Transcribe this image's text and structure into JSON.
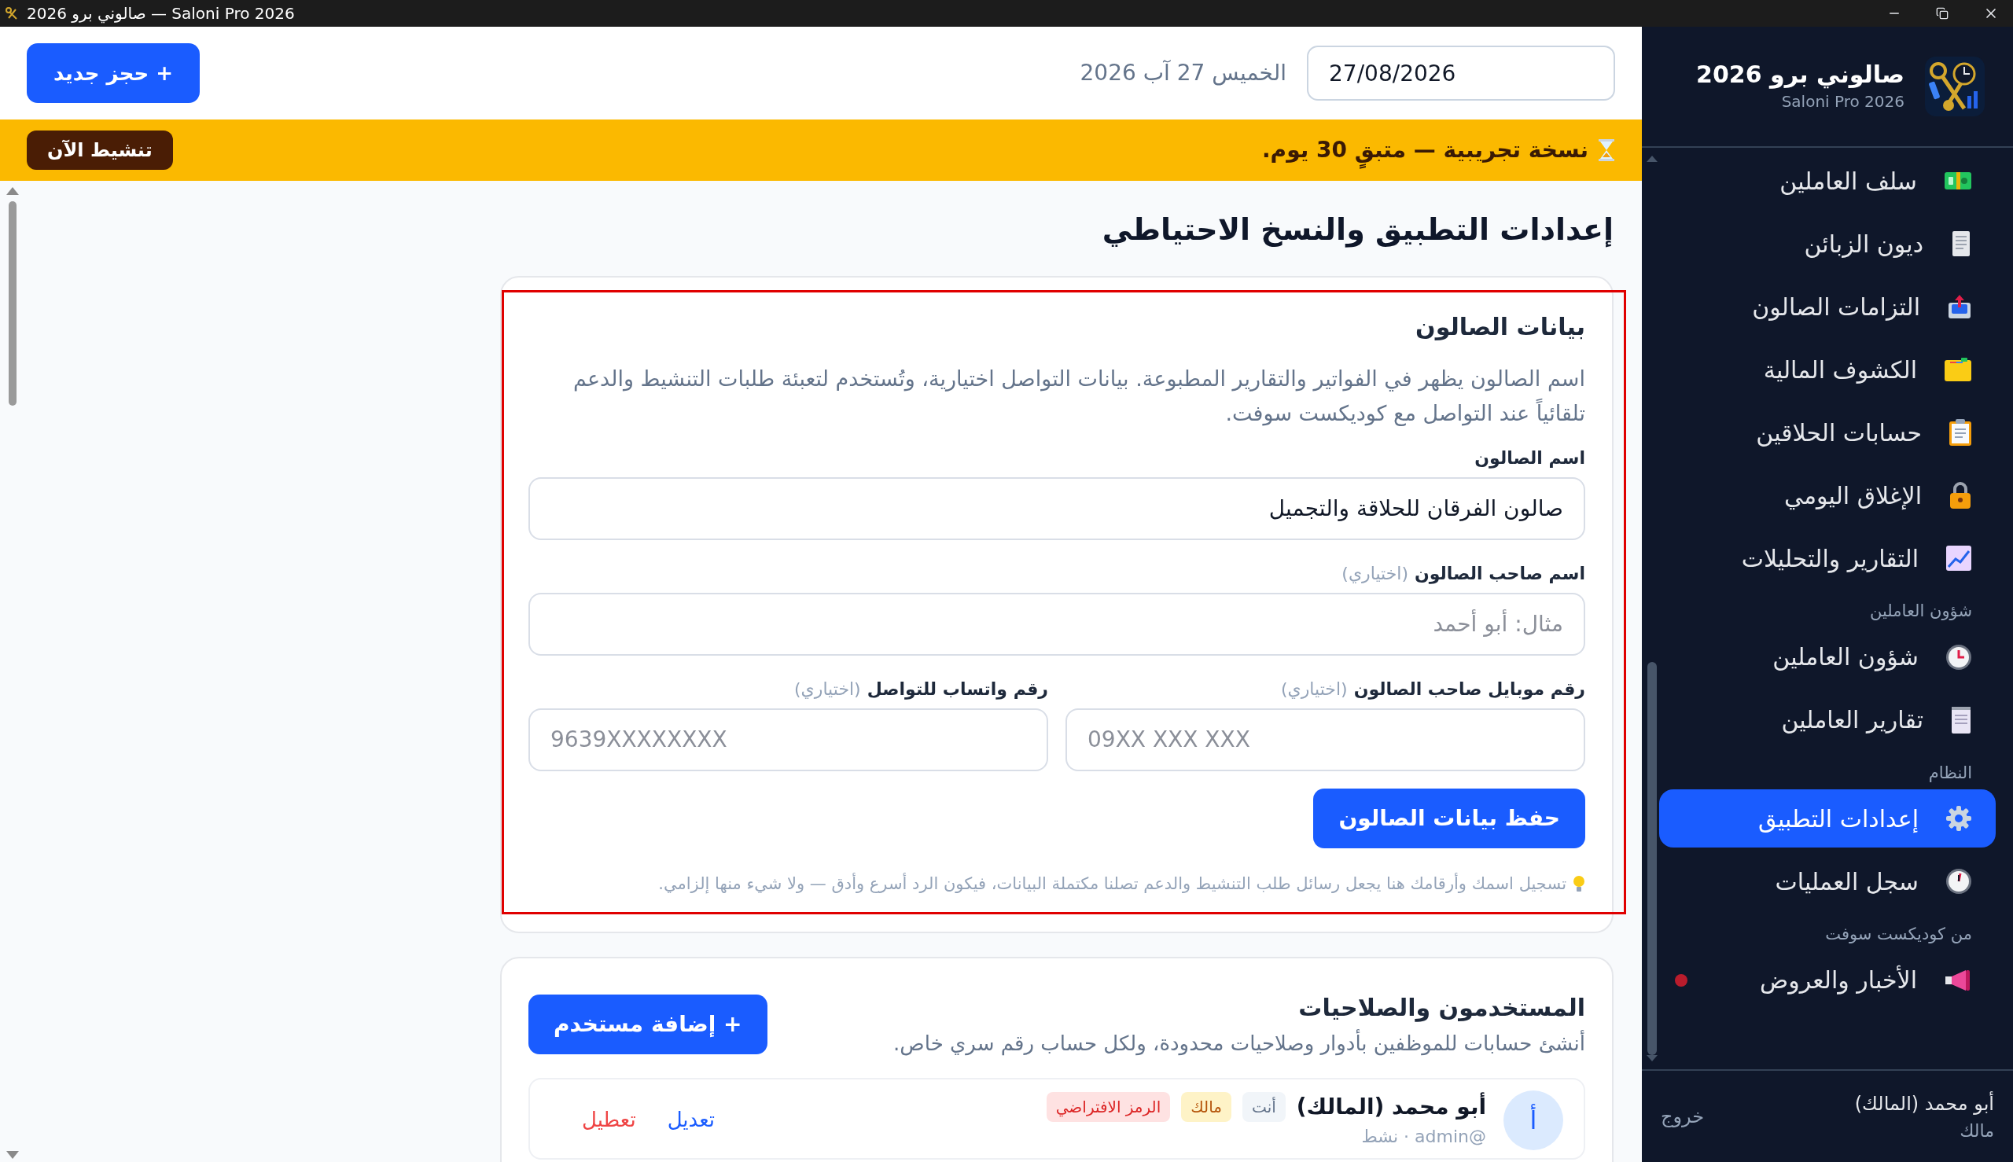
{
  "window": {
    "title": "صالوني برو 2026 — Saloni Pro 2026"
  },
  "header": {
    "new_booking_button": "+ حجز جديد",
    "date_text": "الخميس 27 آب 2026",
    "date_value": "27/08/2026"
  },
  "trial_banner": {
    "message": "نسخة تجريبية — متبقٍ 30 يوم.",
    "activate_button": "تنشيط الآن"
  },
  "page_title": "إعدادات التطبيق والنسخ الاحتياطي",
  "salon_card": {
    "title": "بيانات الصالون",
    "description": "اسم الصالون يظهر في الفواتير والتقارير المطبوعة. بيانات التواصل اختيارية، وتُستخدم لتعبئة طلبات التنشيط والدعم تلقائياً عند التواصل مع كوديكست سوفت.",
    "fields": [
      {
        "label": "اسم الصالون",
        "value": "صالون الفرقان للحلاقة والتجميل"
      },
      {
        "label": "اسم صاحب الصالون",
        "optional": "(اختياري)",
        "placeholder": "مثال: أبو أحمد"
      },
      {
        "label": "رقم موبايل صاحب الصالون",
        "optional": "(اختياري)",
        "placeholder": "09XX XXX XXX"
      },
      {
        "label": "رقم واتساب للتواصل",
        "optional": "(اختياري)",
        "placeholder": "9639XXXXXXXX"
      }
    ],
    "save_button": "حفظ بيانات الصالون",
    "tip": "تسجيل اسمك وأرقامك هنا يجعل رسائل طلب التنشيط والدعم تصلنا مكتملة البيانات، فيكون الرد أسرع وأدق — ولا شيء منها إلزامي."
  },
  "users_card": {
    "title": "المستخدمون والصلاحيات",
    "subtitle": "أنشئ حسابات للموظفين بأدوار وصلاحيات محدودة، ولكل حساب رقم سري خاص.",
    "add_button": "+ إضافة مستخدم",
    "users": [
      {
        "initial": "أ",
        "name": "أبو محمد (المالك)",
        "meta": "@admin · نشط",
        "badges": [
          {
            "text": "أنت",
            "kind": "neutral"
          },
          {
            "text": "مالك",
            "kind": "warning"
          },
          {
            "text": "الرمز الافتراضي",
            "kind": "danger"
          }
        ],
        "actions": [
          {
            "label": "تعديل",
            "kind": "edit"
          },
          {
            "label": "تعطيل",
            "kind": "danger"
          }
        ]
      }
    ]
  },
  "sidebar": {
    "app_name": "صالوني برو 2026",
    "app_subtitle": "Saloni Pro 2026",
    "sections": [
      {
        "items": [
          {
            "label": "سلف العاملين",
            "selected": false,
            "unread": false
          },
          {
            "label": "ديون الزبائن",
            "selected": false,
            "unread": false
          },
          {
            "label": "التزامات الصالون",
            "selected": false,
            "unread": false
          },
          {
            "label": "الكشوف المالية",
            "selected": false,
            "unread": false
          },
          {
            "label": "حسابات الحلاقين",
            "selected": false,
            "unread": false
          },
          {
            "label": "الإغلاق اليومي",
            "selected": false,
            "unread": false
          },
          {
            "label": "التقارير والتحليلات",
            "selected": false,
            "unread": false
          }
        ]
      },
      {
        "label": "شؤون العاملين",
        "items": [
          {
            "label": "شؤون العاملين",
            "selected": false,
            "unread": false
          },
          {
            "label": "تقارير العاملين",
            "selected": false,
            "unread": false
          }
        ]
      },
      {
        "label": "النظام",
        "items": [
          {
            "label": "إعدادات التطبيق",
            "selected": true,
            "unread": false
          },
          {
            "label": "سجل العمليات",
            "selected": false,
            "unread": false
          }
        ]
      },
      {
        "label": "من كوديكست سوفت",
        "items": [
          {
            "label": "الأخبار والعروض",
            "selected": false,
            "unread": true
          }
        ]
      }
    ],
    "user": {
      "name": "أبو محمد (المالك)",
      "role": "مالك"
    },
    "logout": "خروج"
  }
}
